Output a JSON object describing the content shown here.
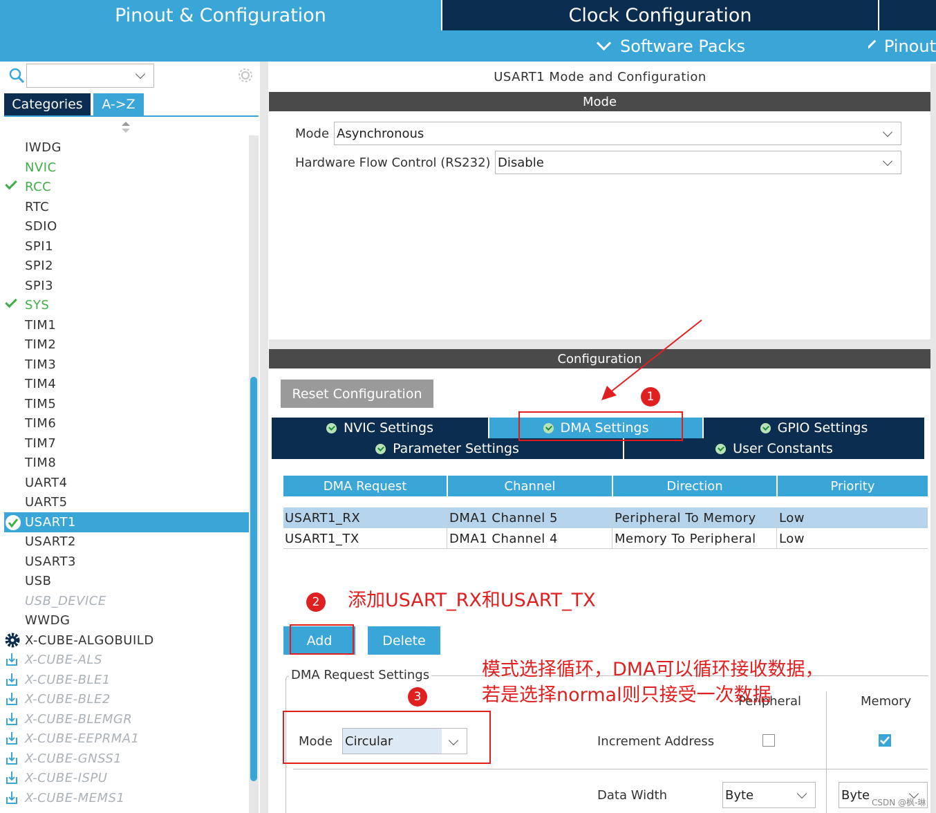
{
  "top_tabs": {
    "pinout": "Pinout & Configuration",
    "clock": "Clock Configuration"
  },
  "sub_tabs": {
    "software_packs": "Software Packs",
    "pinout": "Pinout"
  },
  "left_panel": {
    "search_value": "",
    "tabs": {
      "categories": "Categories",
      "a_z": "A->Z"
    },
    "items": [
      {
        "label": "IWDG"
      },
      {
        "label": "NVIC"
      },
      {
        "label": "RCC"
      },
      {
        "label": "RTC"
      },
      {
        "label": "SDIO"
      },
      {
        "label": "SPI1"
      },
      {
        "label": "SPI2"
      },
      {
        "label": "SPI3"
      },
      {
        "label": "SYS"
      },
      {
        "label": "TIM1"
      },
      {
        "label": "TIM2"
      },
      {
        "label": "TIM3"
      },
      {
        "label": "TIM4"
      },
      {
        "label": "TIM5"
      },
      {
        "label": "TIM6"
      },
      {
        "label": "TIM7"
      },
      {
        "label": "TIM8"
      },
      {
        "label": "UART4"
      },
      {
        "label": "UART5"
      },
      {
        "label": "USART1"
      },
      {
        "label": "USART2"
      },
      {
        "label": "USART3"
      },
      {
        "label": "USB"
      },
      {
        "label": "USB_DEVICE"
      },
      {
        "label": "WWDG"
      },
      {
        "label": "X-CUBE-ALGOBUILD"
      },
      {
        "label": "X-CUBE-ALS"
      },
      {
        "label": "X-CUBE-BLE1"
      },
      {
        "label": "X-CUBE-BLE2"
      },
      {
        "label": "X-CUBE-BLEMGR"
      },
      {
        "label": "X-CUBE-EEPRMA1"
      },
      {
        "label": "X-CUBE-GNSS1"
      },
      {
        "label": "X-CUBE-ISPU"
      },
      {
        "label": "X-CUBE-MEMS1"
      }
    ]
  },
  "main": {
    "title": "USART1 Mode and Configuration",
    "mode_header": "Mode",
    "mode_label": "Mode",
    "mode_value": "Asynchronous",
    "hw_flow_label": "Hardware Flow Control (RS232)",
    "hw_flow_value": "Disable",
    "config_header": "Configuration",
    "reset_button": "Reset Configuration",
    "tabs": {
      "nvic": "NVIC Settings",
      "dma": "DMA Settings",
      "gpio": "GPIO Settings",
      "parameter": "Parameter Settings",
      "user_constants": "User Constants"
    },
    "dma_table": {
      "headers": [
        "DMA Request",
        "Channel",
        "Direction",
        "Priority"
      ],
      "rows": [
        [
          "USART1_RX",
          "DMA1 Channel 5",
          "Peripheral To Memory",
          "Low"
        ],
        [
          "USART1_TX",
          "DMA1 Channel 4",
          "Memory To Peripheral",
          "Low"
        ]
      ]
    },
    "add_button": "Add",
    "delete_button": "Delete",
    "dma_settings": {
      "legend": "DMA Request Settings",
      "peripheral_col": "Peripheral",
      "memory_col": "Memory",
      "mode_label": "Mode",
      "mode_value": "Circular",
      "increment_label": "Increment Address",
      "peripheral_increment": false,
      "memory_increment": true,
      "data_width_label": "Data Width",
      "peripheral_width": "Byte",
      "memory_width": "Byte"
    }
  },
  "annotations": {
    "step1": "1",
    "step2": "2",
    "step3": "3",
    "text_add": "添加USART_RX和USART_TX",
    "text_mode_line1": "模式选择循环，DMA可以循环接收数据，",
    "text_mode_line2": "若是选择normal则只接受一次数据",
    "watermark": "CSDN @枫-琳"
  },
  "colors": {
    "accent": "#3aa6d8",
    "dark_tab": "#0b2d4f",
    "header_grey": "#4a4a4a",
    "annotation_red": "#e02020",
    "ok_green": "#3fae46"
  }
}
